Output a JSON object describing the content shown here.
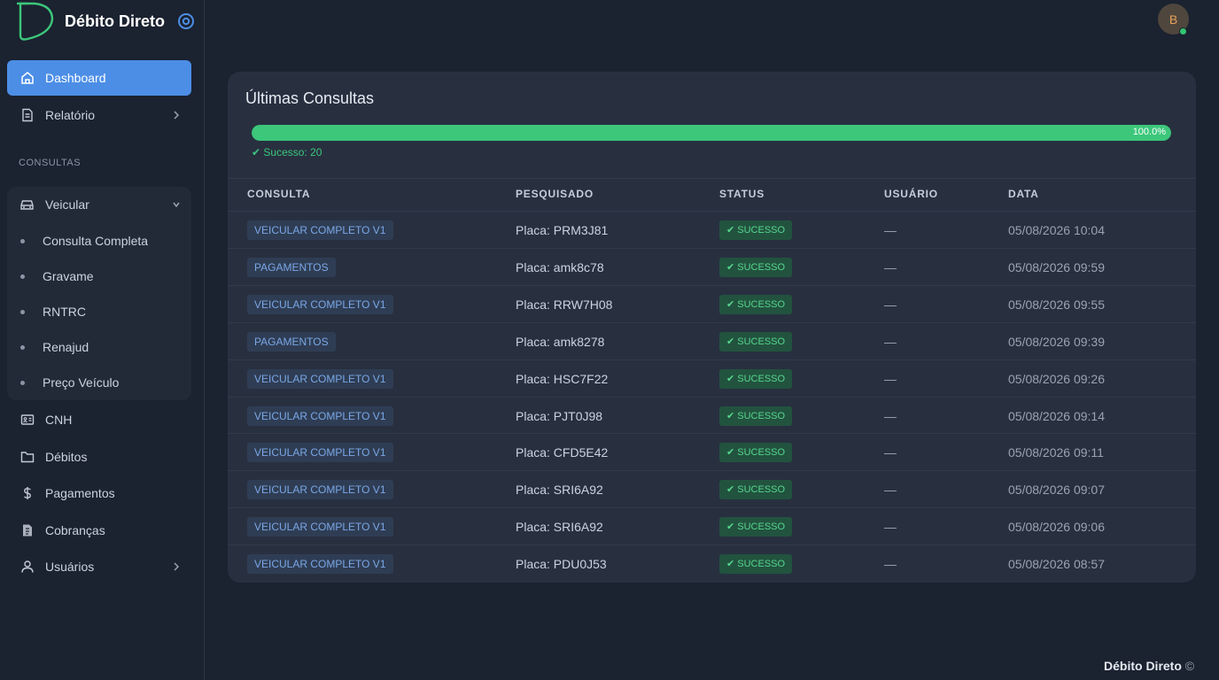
{
  "brand": {
    "title": "Débito Direto"
  },
  "user": {
    "initial": "B"
  },
  "sidebar": {
    "items": [
      {
        "label": "Dashboard",
        "icon": "home-icon"
      },
      {
        "label": "Relatório",
        "icon": "document-icon"
      }
    ],
    "section_label": "CONSULTAS",
    "veicular": {
      "label": "Veicular",
      "subitems": [
        "Consulta Completa",
        "Gravame",
        "RNTRC",
        "Renajud",
        "Preço Veículo"
      ]
    },
    "lower_items": [
      {
        "label": "CNH",
        "icon": "id-card-icon"
      },
      {
        "label": "Débitos",
        "icon": "folder-icon"
      },
      {
        "label": "Pagamentos",
        "icon": "dollar-icon"
      },
      {
        "label": "Cobranças",
        "icon": "receipt-icon"
      },
      {
        "label": "Usuários",
        "icon": "user-icon"
      }
    ]
  },
  "card": {
    "title": "Últimas Consultas",
    "progress_percent": 100,
    "progress_label": "100.0%",
    "success_label": "✔ Sucesso: 20",
    "columns": [
      "CONSULTA",
      "PESQUISADO",
      "STATUS",
      "USUÁRIO",
      "DATA"
    ],
    "rows": [
      {
        "consulta": "VEICULAR COMPLETO V1",
        "pesquisado": "Placa: PRM3J81",
        "status": "✔ SUCESSO",
        "usuario": "—",
        "data": "05/08/2026 10:04"
      },
      {
        "consulta": "PAGAMENTOS",
        "pesquisado": "Placa: amk8c78",
        "status": "✔ SUCESSO",
        "usuario": "—",
        "data": "05/08/2026 09:59"
      },
      {
        "consulta": "VEICULAR COMPLETO V1",
        "pesquisado": "Placa: RRW7H08",
        "status": "✔ SUCESSO",
        "usuario": "—",
        "data": "05/08/2026 09:55"
      },
      {
        "consulta": "PAGAMENTOS",
        "pesquisado": "Placa: amk8278",
        "status": "✔ SUCESSO",
        "usuario": "—",
        "data": "05/08/2026 09:39"
      },
      {
        "consulta": "VEICULAR COMPLETO V1",
        "pesquisado": "Placa: HSC7F22",
        "status": "✔ SUCESSO",
        "usuario": "—",
        "data": "05/08/2026 09:26"
      },
      {
        "consulta": "VEICULAR COMPLETO V1",
        "pesquisado": "Placa: PJT0J98",
        "status": "✔ SUCESSO",
        "usuario": "—",
        "data": "05/08/2026 09:14"
      },
      {
        "consulta": "VEICULAR COMPLETO V1",
        "pesquisado": "Placa: CFD5E42",
        "status": "✔ SUCESSO",
        "usuario": "—",
        "data": "05/08/2026 09:11"
      },
      {
        "consulta": "VEICULAR COMPLETO V1",
        "pesquisado": "Placa: SRI6A92",
        "status": "✔ SUCESSO",
        "usuario": "—",
        "data": "05/08/2026 09:07"
      },
      {
        "consulta": "VEICULAR COMPLETO V1",
        "pesquisado": "Placa: SRI6A92",
        "status": "✔ SUCESSO",
        "usuario": "—",
        "data": "05/08/2026 09:06"
      },
      {
        "consulta": "VEICULAR COMPLETO V1",
        "pesquisado": "Placa: PDU0J53",
        "status": "✔ SUCESSO",
        "usuario": "—",
        "data": "05/08/2026 08:57"
      }
    ]
  },
  "footer": {
    "text": "Débito Direto",
    "copyright": "©"
  },
  "colors": {
    "accent": "#4c8ee6",
    "success": "#3cc77b",
    "background": "#1b2230",
    "card": "#283040"
  }
}
